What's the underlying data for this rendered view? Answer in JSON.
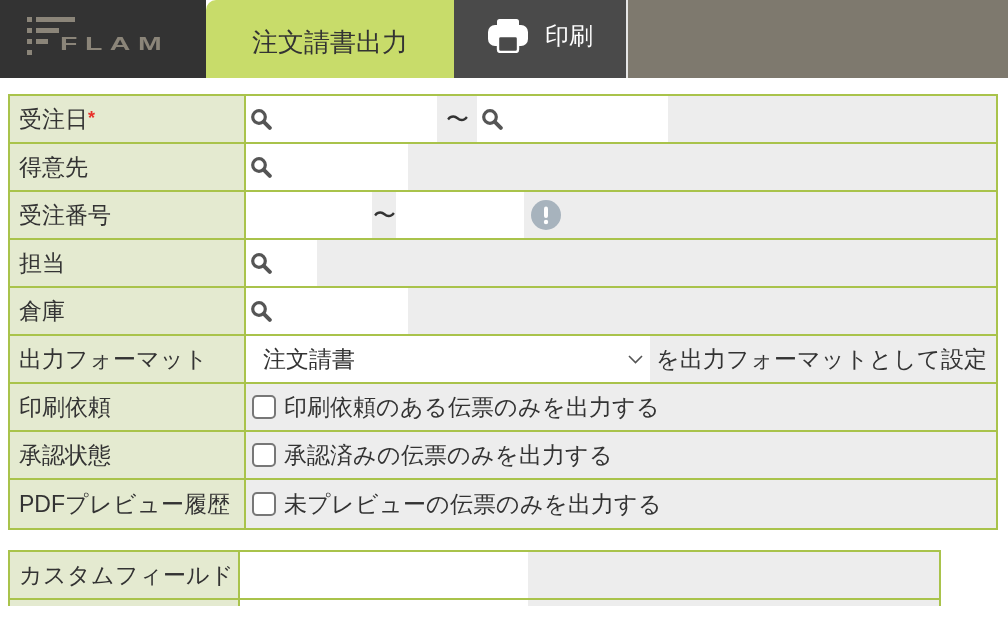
{
  "header": {
    "logo": "FLAM",
    "tabs": [
      {
        "label": "注文請書出力",
        "selected": true
      }
    ],
    "print_button": {
      "label": "印刷"
    }
  },
  "form": {
    "rows": [
      {
        "kind": "date_range",
        "label": "受注日",
        "required_mark": "*",
        "separator": "〜"
      },
      {
        "kind": "lookup",
        "label": "得意先"
      },
      {
        "kind": "number_range",
        "label": "受注番号",
        "separator": "〜"
      },
      {
        "kind": "short_lookup",
        "label": "担当"
      },
      {
        "kind": "lookup",
        "label": "倉庫"
      },
      {
        "kind": "select",
        "label": "出力フォーマット",
        "value": "注文請書",
        "suffix": "を出力フォーマットとして設定"
      },
      {
        "kind": "checkbox",
        "label": "印刷依頼",
        "checked": false,
        "text": "印刷依頼のある伝票のみを出力する"
      },
      {
        "kind": "checkbox",
        "label": "承認状態",
        "checked": false,
        "text": "承認済みの伝票のみを出力する"
      },
      {
        "kind": "checkbox",
        "label": "PDFプレビュー履歴",
        "checked": false,
        "text": "未プレビューの伝票のみを出力する"
      }
    ]
  },
  "custom_fields": {
    "rows": [
      {
        "label": "カスタムフィールド"
      }
    ]
  }
}
